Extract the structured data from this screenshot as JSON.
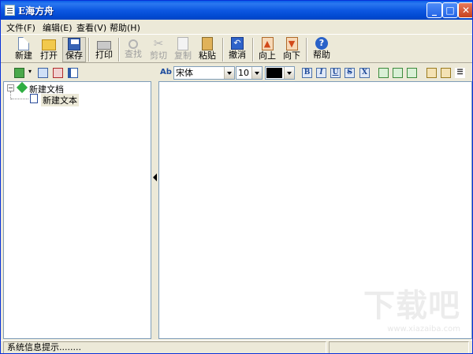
{
  "window": {
    "title": "E海方舟"
  },
  "menu": [
    {
      "label": "文件(F)"
    },
    {
      "label": "编辑(E)"
    },
    {
      "label": "查看(V)"
    },
    {
      "label": "帮助(H)"
    }
  ],
  "toolbar": [
    {
      "label": "新建",
      "enabled": true
    },
    {
      "label": "打开",
      "enabled": true
    },
    {
      "label": "保存",
      "enabled": true
    },
    {
      "label": "打印",
      "enabled": true
    },
    {
      "label": "查找",
      "enabled": false
    },
    {
      "label": "剪切",
      "enabled": false
    },
    {
      "label": "复制",
      "enabled": false
    },
    {
      "label": "粘贴",
      "enabled": true
    },
    {
      "label": "撤消",
      "enabled": true
    },
    {
      "label": "向上",
      "enabled": true
    },
    {
      "label": "向下",
      "enabled": true
    },
    {
      "label": "帮助",
      "enabled": true
    }
  ],
  "tree": {
    "root": "新建文档",
    "child": "新建文本"
  },
  "format": {
    "ab": "Ab",
    "font": "宋体",
    "size": "10",
    "color": "#000000",
    "bold": "B",
    "italic": "I",
    "underline": "U",
    "strike": "S",
    "clear": "X"
  },
  "status": {
    "message": "系统信息提示........"
  },
  "watermark": {
    "brand": "下载吧",
    "url": "www.xiazaiba.com"
  }
}
